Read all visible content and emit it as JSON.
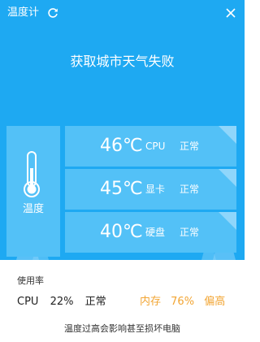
{
  "window": {
    "title": "温度计",
    "refresh_icon": "refresh-icon",
    "close_icon": "close-icon"
  },
  "weather": {
    "status": "获取城市天气失败"
  },
  "temperature_panel": {
    "label": "温度",
    "icon": "thermometer-icon"
  },
  "readings": [
    {
      "temp": "46℃",
      "name": "CPU",
      "status": "正常"
    },
    {
      "temp": "45℃",
      "name": "显卡",
      "status": "正常"
    },
    {
      "temp": "40℃",
      "name": "硬盘",
      "status": "正常"
    }
  ],
  "usage": {
    "label": "使用率",
    "cpu_name": "CPU",
    "cpu_value": "22%",
    "cpu_status": "正常",
    "mem_name": "内存",
    "mem_value": "76%",
    "mem_status": "偏高"
  },
  "footer": {
    "warning": "温度过高会影响甚至损坏电脑"
  },
  "colors": {
    "background": "#1ea9f2",
    "panel": "#53c1f7",
    "warning": "#f2a533"
  }
}
